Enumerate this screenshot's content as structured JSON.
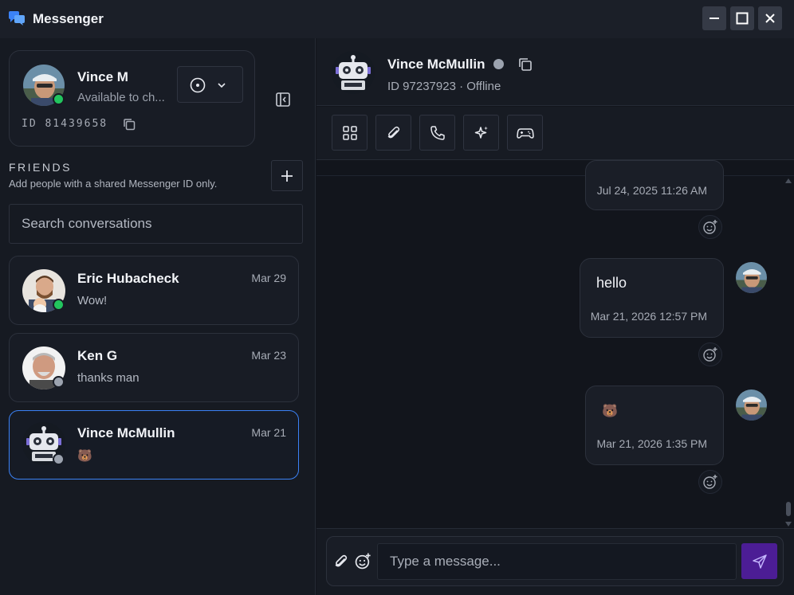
{
  "app": {
    "title": "Messenger"
  },
  "window_controls": {
    "minimize": "minimize-icon",
    "maximize": "maximize-icon",
    "close": "close-icon"
  },
  "profile": {
    "name": "Vince M",
    "status_text": "Available to ch...",
    "id_label": "ID 81439658",
    "presence_color": "#22c55e"
  },
  "friends": {
    "heading": "FRIENDS",
    "subtitle": "Add people with a shared Messenger ID only.",
    "search_placeholder": "Search conversations"
  },
  "conversations": [
    {
      "name": "Eric Hubacheck",
      "preview": "Wow!",
      "date": "Mar 29",
      "presence": "online"
    },
    {
      "name": "Ken G",
      "preview": "thanks man",
      "date": "Mar 23",
      "presence": "offline"
    },
    {
      "name": "Vince McMullin",
      "preview": "🐻",
      "date": "Mar 21",
      "presence": "offline",
      "active": true
    }
  ],
  "chat": {
    "name": "Vince McMullin",
    "subtitle": "ID 97237923 · Offline",
    "toolbar": [
      "apps-grid-icon",
      "paperclip-icon",
      "phone-icon",
      "sparkles-icon",
      "gamepad-icon"
    ],
    "messages": [
      {
        "text": "",
        "time": "Jul 24, 2025 11:26 AM"
      },
      {
        "text": "hello",
        "time": "Mar 21, 2026 12:57 PM"
      },
      {
        "text": "🐻",
        "time": "Mar 21, 2026 1:35 PM"
      }
    ]
  },
  "composer": {
    "placeholder": "Type a message..."
  },
  "colors": {
    "accent": "#3b82f6",
    "send": "#4c1d95",
    "online": "#22c55e",
    "offline": "#9ca3af"
  }
}
